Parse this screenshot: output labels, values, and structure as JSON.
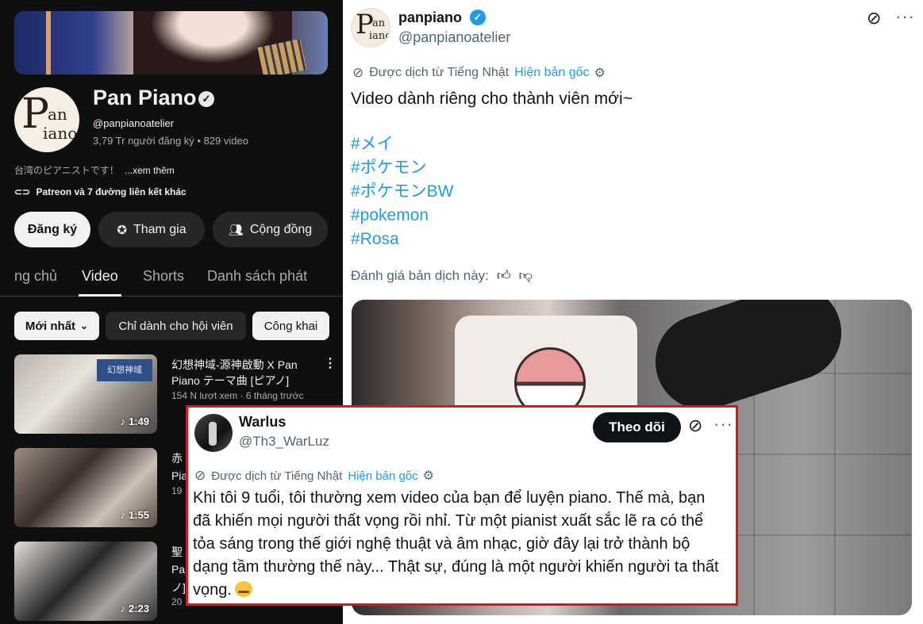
{
  "youtube": {
    "channel_name": "Pan Piano",
    "handle": "@panpianoatelier",
    "stats": "3,79 Tr người đăng ký • 829 video",
    "description": "台湾のピアニストです！",
    "description_more": "...xem thêm",
    "links": "Patreon và 7 đường liên kết khác",
    "buttons": {
      "subscribe": "Đăng ký",
      "join": "Tham gia",
      "community": "Cộng đồng"
    },
    "tabs": [
      "ng chủ",
      "Video",
      "Shorts",
      "Danh sách phát"
    ],
    "active_tab": "Video",
    "chips": {
      "sort": "Mới nhất",
      "members": "Chỉ dành cho hội viên",
      "public": "Công khai"
    },
    "videos": [
      {
        "title": "幻想神域-源神啟動 X Pan Piano テーマ曲 [ピアノ]",
        "meta": "154 N lượt xem · 6 tháng trước",
        "duration": "1:49",
        "thumb_label": "幻想神域"
      },
      {
        "title": "赤",
        "meta": "Pia",
        "meta2": "19",
        "duration": "1:55"
      },
      {
        "title": "聖",
        "meta": "Pa",
        "meta2": "ノ]",
        "meta3": "20",
        "duration": "2:23"
      }
    ],
    "avatar_letters": {
      "p": "P",
      "an": "an",
      "iano": "iano"
    }
  },
  "tweet": {
    "name": "panpiano",
    "handle": "@panpianoatelier",
    "translated_from": "Được dịch từ Tiếng Nhật",
    "show_original": "Hiện bản gốc",
    "body": "Video dành riêng cho thành viên mới~",
    "hashtags": [
      "#メイ",
      "#ポケモン",
      "#ポケモンBW",
      "#pokemon",
      "#Rosa"
    ],
    "rate_translation": "Đánh giá bản dịch này:",
    "accent": "#1d9bf0"
  },
  "reply": {
    "name": "Warlus",
    "handle": "@Th3_WarLuz",
    "follow": "Theo dõi",
    "translated_from": "Được dịch từ Tiếng Nhật",
    "show_original": "Hiện bản gốc",
    "lines": [
      "Khi tôi 9 tuổi, tôi thường xem video của bạn để luyện piano. Thế mà, bạn",
      "đã khiến mọi người thất vọng rồi nhỉ. Từ một pianist xuất sắc lẽ ra có thể",
      "tỏa sáng trong thế giới nghệ thuật và âm nhạc, giờ đây lại trở thành bộ",
      "dạng tầm thường thế này... Thật sự, đúng là một người khiến người ta thất",
      "vọng."
    ],
    "border_color": "#d4171d"
  }
}
